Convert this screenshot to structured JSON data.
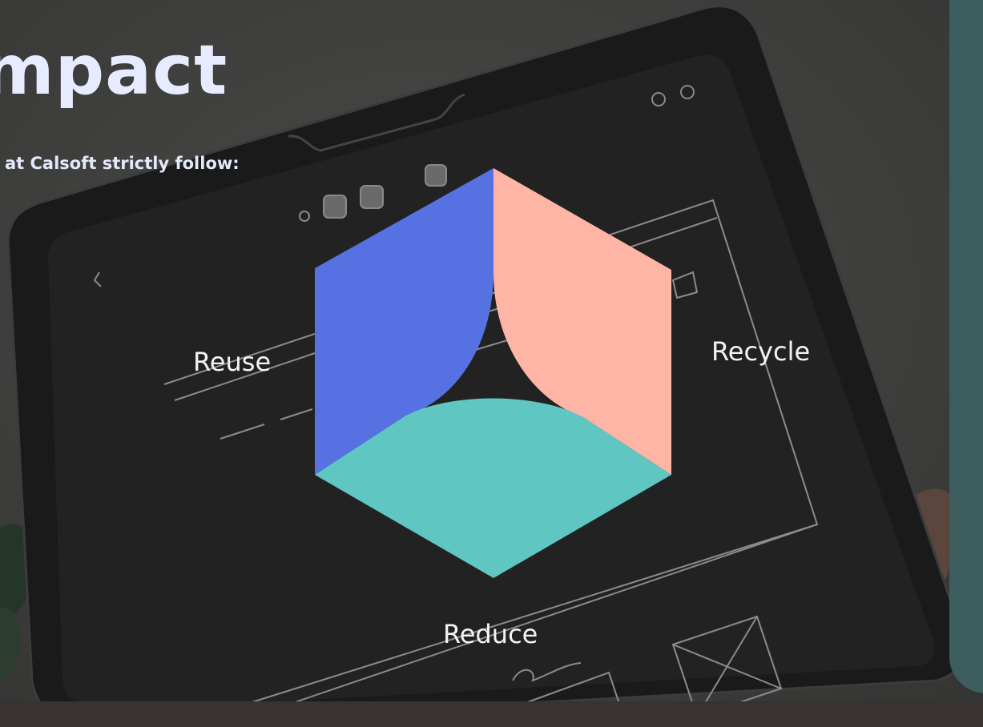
{
  "slide": {
    "title": "mpact",
    "subtitle": "at Calsoft strictly follow:"
  },
  "diagram": {
    "type": "hexagon-3-segment",
    "segments": [
      {
        "label": "Reuse",
        "color": "#5672e2"
      },
      {
        "label": "Recycle",
        "color": "#ffb5a5"
      },
      {
        "label": "Reduce",
        "color": "#60c6c2"
      }
    ]
  },
  "colors": {
    "side_panel": "#3d5e5e",
    "heading": "#e7ebff"
  }
}
